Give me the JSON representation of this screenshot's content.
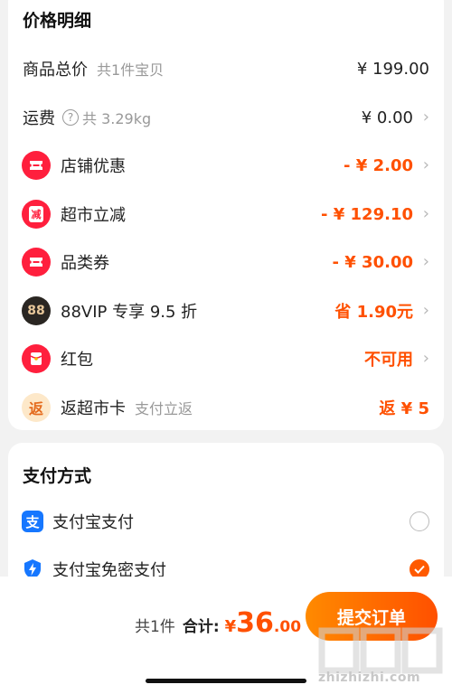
{
  "price_detail": {
    "title": "价格明细",
    "rows": [
      {
        "label": "商品总价",
        "sub": "共1件宝贝",
        "value": "¥ 199.00",
        "icon": ""
      },
      {
        "label": "运费",
        "sub": "共 3.29kg",
        "value": "¥ 0.00",
        "icon": "question-icon"
      },
      {
        "label": "店铺优惠",
        "value": "- ¥ 2.00",
        "icon": "ticket-icon"
      },
      {
        "label": "超市立减",
        "value": "- ¥ 129.10",
        "icon": "reduce-tag-icon",
        "icon_text": "减"
      },
      {
        "label": "品类券",
        "value": "- ¥ 30.00",
        "icon": "ticket-icon"
      },
      {
        "label": "88VIP 专享 9.5 折",
        "value": "省 1.90元",
        "icon": "vip88-icon",
        "icon_text": "88"
      },
      {
        "label": "红包",
        "value": "不可用",
        "icon": "red-envelope-icon"
      },
      {
        "label": "返超市卡",
        "sub": "支付立返",
        "value": "返 ¥ 5",
        "icon": "cashback-icon",
        "icon_text": "返"
      }
    ]
  },
  "payment": {
    "title": "支付方式",
    "options": [
      {
        "label": "支付宝支付",
        "icon": "alipay-icon",
        "checked": false
      },
      {
        "label": "支付宝免密支付",
        "icon": "shield-lightning-icon",
        "checked": true
      }
    ]
  },
  "footer": {
    "count": "共1件",
    "sum_label": "合计:",
    "currency": "¥",
    "amount_int": "36",
    "amount_cents": ".00",
    "submit_label": "提交订单"
  },
  "watermark": {
    "text": "zhizhizhi.com"
  },
  "colors": {
    "accent": "#ff5000",
    "red_icon": "#ff1f3d",
    "gray_text": "#999999"
  }
}
